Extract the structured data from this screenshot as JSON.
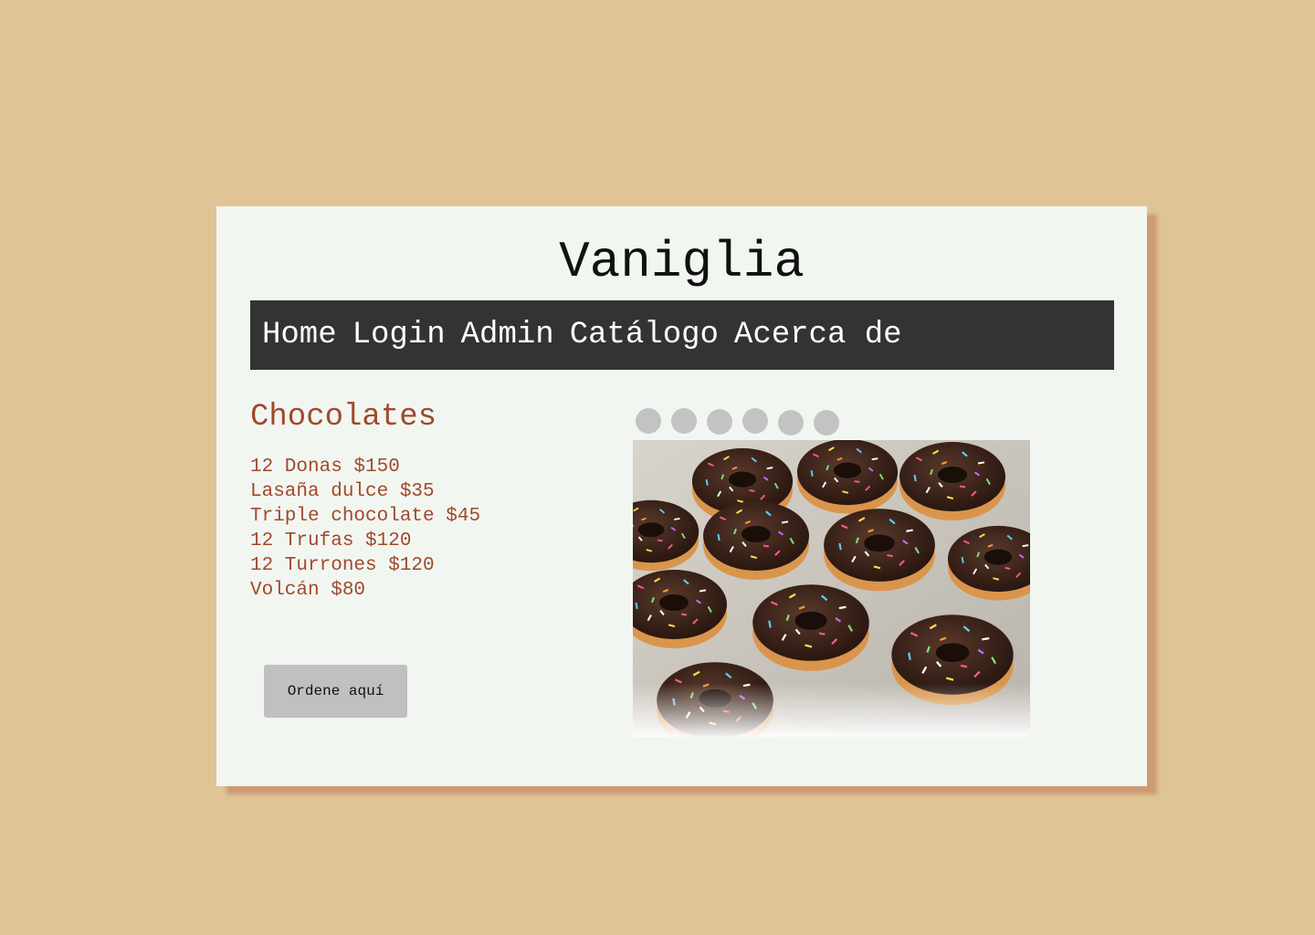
{
  "site": {
    "title": "Vaniglia"
  },
  "nav": {
    "items": [
      {
        "label": "Home"
      },
      {
        "label": "Login"
      },
      {
        "label": "Admin"
      },
      {
        "label": "Catálogo"
      },
      {
        "label": "Acerca de"
      }
    ]
  },
  "section": {
    "title": "Chocolates",
    "items": [
      {
        "label": "12 Donas $150"
      },
      {
        "label": "Lasaña dulce $35"
      },
      {
        "label": "Triple chocolate $45"
      },
      {
        "label": "12 Trufas $120"
      },
      {
        "label": "12 Turrones $120"
      },
      {
        "label": "Volcán $80"
      }
    ],
    "order_button": "Ordene aquí"
  },
  "carousel": {
    "slide_count": 6,
    "image_subject": "chocolate-frosted donuts with rainbow sprinkles"
  },
  "colors": {
    "page_background": "#dfc495",
    "card_background": "#f2f6f1",
    "card_shadow": "#cc9a73",
    "nav_background": "#333333",
    "accent_text": "#a0492c",
    "button_background": "#c0c0c0",
    "carousel_dot": "#c3c3c3"
  }
}
